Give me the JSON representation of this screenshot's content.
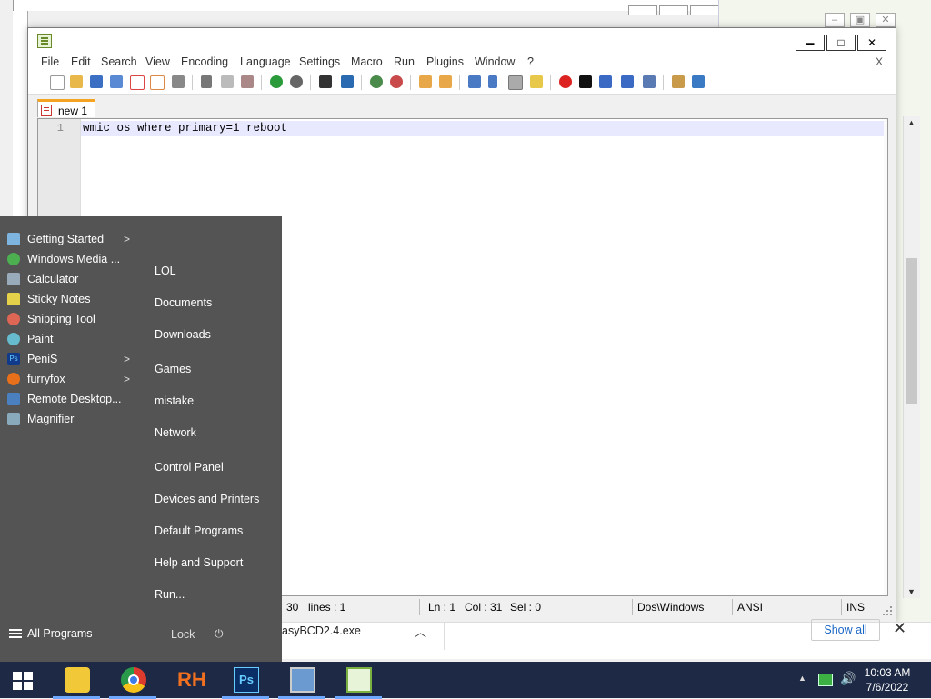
{
  "notepad": {
    "menu": [
      "File",
      "Edit",
      "Search",
      "View",
      "Encoding",
      "Language",
      "Settings",
      "Macro",
      "Run",
      "Plugins",
      "Window",
      "?"
    ],
    "menu_close": "X",
    "window_buttons": {
      "minimize": "▬",
      "maximize": "□",
      "close": "✕"
    },
    "tab": {
      "label": "new 1"
    },
    "editor": {
      "line_number": "1",
      "text": "wmic os where primary=1 reboot"
    },
    "status": {
      "length": "30",
      "lines": "lines : 1",
      "ln": "Ln : 1",
      "col": "Col : 31",
      "sel": "Sel : 0",
      "eol": "Dos\\Windows",
      "encoding": "ANSI",
      "mode": "INS"
    }
  },
  "download_bar": {
    "filename": "asyBCD2.4.exe",
    "show_all": "Show all",
    "close": "✕"
  },
  "start_menu": {
    "pinned": [
      {
        "label": "Getting Started",
        "icon": "getting-started-icon",
        "submenu": true,
        "color": "#7db4e0"
      },
      {
        "label": "Windows Media ...",
        "icon": "media-player-icon",
        "submenu": false,
        "color": "#4caf50"
      },
      {
        "label": "Calculator",
        "icon": "calculator-icon",
        "submenu": false,
        "color": "#9ab"
      },
      {
        "label": "Sticky Notes",
        "icon": "sticky-notes-icon",
        "submenu": false,
        "color": "#e6d24a"
      },
      {
        "label": "Snipping Tool",
        "icon": "snipping-tool-icon",
        "submenu": false,
        "color": "#d65"
      },
      {
        "label": "Paint",
        "icon": "paint-icon",
        "submenu": false,
        "color": "#6bc"
      },
      {
        "label": "PeniS",
        "icon": "photoshop-icon",
        "submenu": true,
        "color": "#123a8a"
      },
      {
        "label": "furryfox",
        "icon": "firefox-icon",
        "submenu": true,
        "color": "#e8701a"
      },
      {
        "label": "Remote Desktop...",
        "icon": "remote-desktop-icon",
        "submenu": false,
        "color": "#4a7fc0"
      },
      {
        "label": "Magnifier",
        "icon": "magnifier-icon",
        "submenu": false,
        "color": "#8ab"
      }
    ],
    "places": [
      "LOL",
      "Documents",
      "Downloads",
      "Games",
      "mistake",
      "Network",
      "Control Panel",
      "Devices and Printers",
      "Default Programs",
      "Help and Support",
      "Run..."
    ],
    "all_programs": "All Programs",
    "lock": "Lock",
    "power_icon": "power-icon"
  },
  "taskbar": {
    "apps": [
      {
        "name": "file-explorer",
        "icon": "folder-icon",
        "color": "#f0c838"
      },
      {
        "name": "chrome",
        "icon": "chrome-icon",
        "color": "#dd3b2e"
      },
      {
        "name": "rh",
        "icon": "rh-icon",
        "color": "#f07020"
      },
      {
        "name": "photoshop",
        "icon": "photoshop-icon",
        "color": "#0a2e66"
      },
      {
        "name": "computer",
        "icon": "computer-icon",
        "color": "#6a9ad0"
      },
      {
        "name": "notepad-plus-plus",
        "icon": "notepad-plus-plus-icon",
        "color": "#7ab040"
      }
    ],
    "clock": {
      "time": "10:03 AM",
      "date": "7/6/2022"
    }
  },
  "colors": {
    "start_menu_bg": "#545454",
    "taskbar_bg": "#1e2a45",
    "tab_accent": "#f4a422",
    "line_highlight": "#e8e8ff",
    "link_blue": "#1a66c6"
  }
}
